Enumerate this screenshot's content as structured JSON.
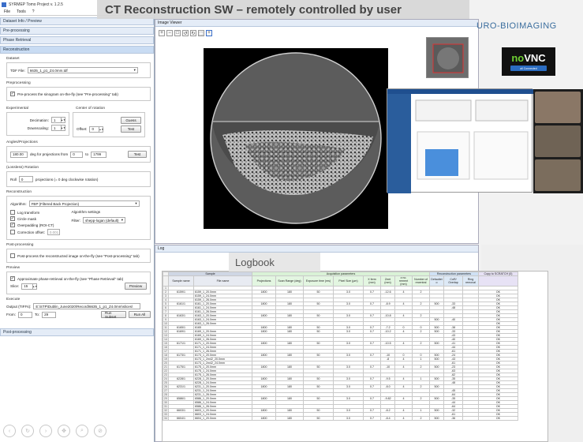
{
  "banner": {
    "title": "CT Reconstruction SW – remotely controlled by user"
  },
  "app": {
    "title": "SYRMEP Tomo Project v. 1.2.5",
    "menu": [
      "File",
      "Tools",
      "?"
    ],
    "sections": {
      "dataset": "Dataset Info / Preview",
      "preprocessing": "Pre-processing",
      "phase": "Phase Retrieval",
      "reconstruction": "Reconstruction",
      "postprocessing": "Post-processing"
    },
    "dataset_label": "Dataset",
    "tdf_label": "TDF File:",
    "tdf_value": "6635_1_p1_Z4.0mm.tdf",
    "preprocessing_label": "Preprocessing",
    "preprocess_check": "Pre-process the sinogram on-the-fly (see \"Pre-processing\" tab)",
    "experimental_label": "Experimental",
    "cor_label": "Center of rotation",
    "decimation_label": "Decimation:",
    "decimation_value": "1",
    "downscaling_label": "Downscaling:",
    "downscaling_value": "1",
    "offset_label": "Offset:",
    "offset_value": "0",
    "guess_btn": "Guess",
    "test_btn": "Test",
    "angles_label": "Angles/Projections",
    "angle_value": "180.00",
    "angle_text": "deg for projections from",
    "from_value": "0",
    "to_text": "to",
    "to_value": "1799",
    "test2_btn": "Test",
    "lossless_label": "(Lossless) Rotation",
    "roll_label": "Roll",
    "roll_value": "0",
    "roll_text": "projections (= 0 deg clockwise rotation)",
    "recon_label": "Reconstruction",
    "algorithm_label": "Algorithm:",
    "algorithm_value": "FBP (Filtered Back Projection)",
    "algo_settings_label": "Algorithm settings",
    "log_transform": "Log transform",
    "circle_mask": "Circle mask",
    "overpadding": "Overpadding (ROI-CT)",
    "correction_offset": "Correction offset:",
    "correction_value": "0.001",
    "filter_label": "Filter:",
    "filter_value": "shepp-logan (default)",
    "postproc_label": "Post-processing",
    "postproc_check": "Post-process the reconstructed image on-the-fly (see \"Post-processing\" tab)",
    "preview_label": "Preview",
    "preview_check": "Approximate phase-retrieval on-the-fly (see \"Phase Retrieval\" tab)",
    "slice_label": "Slice:",
    "slice_value": "15",
    "preview_btn": "Preview",
    "execute_label": "Execute",
    "output_label": "Output (TIFFs):",
    "output_value": "E:\\STP\\Dublin_June2020\\Record\\6635_1_p1_Z4.0mm\\slices\\",
    "from_label": "From:",
    "exec_from": "0",
    "exec_to_label": "To:",
    "exec_to": "29",
    "run_subset": "Run Subset",
    "run_all": "Run All"
  },
  "viewer": {
    "title": "Image Viewer"
  },
  "right": {
    "euro": "URO-BIOIMAGING",
    "vnc_no": "no",
    "vnc_rest": "VNC",
    "vnc_btn": "all Connected"
  },
  "log": {
    "title": "Log",
    "logbook": "Logbook",
    "group_headers": [
      "Sample",
      "Acquisition parameters",
      "Reconstruction parameters",
      "Copy to SCRATCH (0)"
    ],
    "columns": [
      "Sample name",
      "File name",
      "Projections",
      "Scan Range (deg)",
      "Exposure time (ms)",
      "Pixel Size (µm)",
      "X ferm (mm)",
      "Zeet (mm)",
      "z no. rement (mm)",
      "Number of recentral",
      "Defaultet o",
      "CoR/ Overlap",
      "Ring removal",
      ""
    ],
    "rows": [
      [
        "1",
        "",
        "",
        "",
        "",
        "",
        "",
        "",
        "",
        "",
        "",
        "",
        "",
        "",
        ""
      ],
      [
        "2",
        "6159/1",
        "6159_1_20.0mm",
        "1800",
        "180",
        "50",
        "3.0",
        "0.7",
        "-12.6",
        "4",
        "2",
        "",
        "",
        "",
        "OK"
      ],
      [
        "3",
        "",
        "6159_1_24.0mm",
        "",
        "",
        "",
        "",
        "",
        "",
        "",
        "",
        "",
        "",
        "",
        "OK"
      ],
      [
        "4",
        "",
        "6159_1_26.0mm",
        "",
        "",
        "",
        "",
        "",
        "",
        "",
        "",
        "",
        "",
        "",
        "OK"
      ],
      [
        "5",
        "6161/1",
        "6161_1_20.0mm",
        "1800",
        "180",
        "50",
        "3.0",
        "0.7",
        "-8.9",
        "4",
        "2",
        "500",
        "-33",
        "",
        "OK"
      ],
      [
        "6",
        "",
        "6161_1_24.0mm",
        "",
        "",
        "",
        "",
        "",
        "",
        "",
        "",
        "",
        "-48",
        "",
        "OK"
      ],
      [
        "7",
        "",
        "6161_1_26.0mm",
        "",
        "",
        "",
        "",
        "",
        "",
        "",
        "",
        "",
        "",
        "",
        "OK"
      ],
      [
        "8",
        "6163/1",
        "6163_1_20.0mm",
        "1800",
        "180",
        "50",
        "3.0",
        "0.7",
        "-10.8",
        "4",
        "2",
        "",
        "",
        "",
        "OK"
      ],
      [
        "9",
        "",
        "6163_1_24.0mm",
        "",
        "",
        "",
        "",
        "",
        "",
        "",
        "",
        "500",
        "-40",
        "",
        "OK"
      ],
      [
        "10",
        "",
        "6163_1_26.0mm",
        "",
        "",
        "",
        "",
        "",
        "",
        "",
        "",
        "",
        "",
        "",
        "OK"
      ],
      [
        "11",
        "6165/1",
        "6165",
        "1800",
        "180",
        "50",
        "3.0",
        "0.7",
        "-7.2",
        "0",
        "0",
        "500",
        "-38",
        "",
        "OK"
      ],
      [
        "12",
        "6169/1",
        "6169_1_20.0mm",
        "1800",
        "180",
        "50",
        "3.0",
        "0.7",
        "-10.2",
        "4",
        "2",
        "500",
        "-33",
        "",
        "OK"
      ],
      [
        "13",
        "",
        "6169_1_24.0mm",
        "",
        "",
        "",
        "",
        "",
        "",
        "",
        "",
        "",
        "-43",
        "",
        "OK"
      ],
      [
        "14",
        "",
        "6169_1_26.0mm",
        "",
        "",
        "",
        "",
        "",
        "",
        "",
        "",
        "",
        "-40",
        "",
        "OK"
      ],
      [
        "15",
        "6171/1",
        "6171_1_20.0mm",
        "1800",
        "180",
        "50",
        "3.0",
        "0.7",
        "-10.5",
        "4",
        "2",
        "500",
        "-41",
        "",
        "OK"
      ],
      [
        "16",
        "",
        "6171_1_24.0mm",
        "",
        "",
        "",
        "",
        "",
        "",
        "",
        "",
        "",
        "-44",
        "",
        "OK"
      ],
      [
        "17",
        "",
        "6171_1_26.0mm",
        "",
        "",
        "",
        "",
        "",
        "",
        "",
        "",
        "",
        "-61",
        "",
        "OK"
      ],
      [
        "18",
        "6173/1",
        "6173_1_20.0mm",
        "1800",
        "180",
        "50",
        "3.0",
        "0.7",
        "-10",
        "0",
        "0",
        "500",
        "-24",
        "",
        "OK"
      ],
      [
        "19",
        "",
        "6173_1_2m42_20.0mm",
        "",
        "",
        "",
        "",
        "",
        "-8",
        "4",
        "1",
        "500",
        "-43",
        "",
        "OK"
      ],
      [
        "20",
        "",
        "6173_1_2m42_24.0mm",
        "",
        "",
        "",
        "",
        "",
        "",
        "",
        "",
        "",
        "-61",
        "",
        "OK"
      ],
      [
        "21",
        "6175/1",
        "6175_1_20.0mm",
        "1800",
        "180",
        "50",
        "3.0",
        "0.7",
        "-10",
        "4",
        "2",
        "500",
        "-23",
        "",
        "OK"
      ],
      [
        "22",
        "",
        "6175_1_24.0mm",
        "",
        "",
        "",
        "",
        "",
        "",
        "",
        "",
        "",
        "-63",
        "",
        "OK"
      ],
      [
        "23",
        "",
        "6175_1_26.0mm",
        "",
        "",
        "",
        "",
        "",
        "",
        "",
        "",
        "",
        "-62",
        "",
        "OK"
      ],
      [
        "24",
        "6228/1",
        "6228_1_20.0mm",
        "1800",
        "180",
        "50",
        "3.0",
        "0.7",
        "-9.5",
        "4",
        "1",
        "500",
        "-35",
        "",
        "OK"
      ],
      [
        "25",
        "",
        "6228_1_24.0mm",
        "",
        "",
        "",
        "",
        "",
        "",
        "",
        "",
        "",
        "-48",
        "",
        "OK"
      ],
      [
        "26",
        "6231/1",
        "6231_1_20.0mm",
        "1800",
        "180",
        "50",
        "3.0",
        "0.7",
        "-8.0",
        "4",
        "2",
        "500",
        "",
        "",
        "OK"
      ],
      [
        "27",
        "",
        "6231_1_24.0mm",
        "",
        "",
        "",
        "",
        "",
        "",
        "",
        "",
        "",
        "-45",
        "",
        "OK"
      ],
      [
        "28",
        "",
        "6231_1_26.0mm",
        "",
        "",
        "",
        "",
        "",
        "",
        "",
        "",
        "",
        "-64",
        "",
        "OK"
      ],
      [
        "29",
        "6586/1",
        "6586_1_20.0mm",
        "1800",
        "180",
        "50",
        "3.0",
        "0.7",
        "-9.82",
        "4",
        "2",
        "500",
        "-35",
        "",
        "OK"
      ],
      [
        "30",
        "",
        "6586_1_24.0mm",
        "",
        "",
        "",
        "",
        "",
        "",
        "",
        "",
        "",
        "-44",
        "",
        "OK"
      ],
      [
        "31",
        "",
        "6586_1_26.0mm",
        "",
        "",
        "",
        "",
        "",
        "",
        "",
        "",
        "",
        "-64",
        "",
        "OK"
      ],
      [
        "32",
        "6603/1",
        "6603_1_20.0mm",
        "1800",
        "180",
        "50",
        "3.0",
        "0.7",
        "-8.2",
        "4",
        "1",
        "500",
        "-32",
        "",
        "OK"
      ],
      [
        "33",
        "",
        "6603_1_24.0mm",
        "",
        "",
        "",
        "",
        "",
        "",
        "",
        "",
        "",
        "-61",
        "",
        "OK"
      ],
      [
        "34",
        "6604/1",
        "6604_1_20.0mm",
        "1800",
        "180",
        "50",
        "3.0",
        "0.7",
        "-8.4",
        "4",
        "2",
        "500",
        "-36",
        "",
        "OK"
      ]
    ]
  },
  "colors": {
    "accent": "#3a6ec9",
    "vnc_green": "#6fd033",
    "sample_head": "#cfd6e4",
    "acq_head": "#d9f2d6",
    "rec_head": "#cfe1f4"
  }
}
